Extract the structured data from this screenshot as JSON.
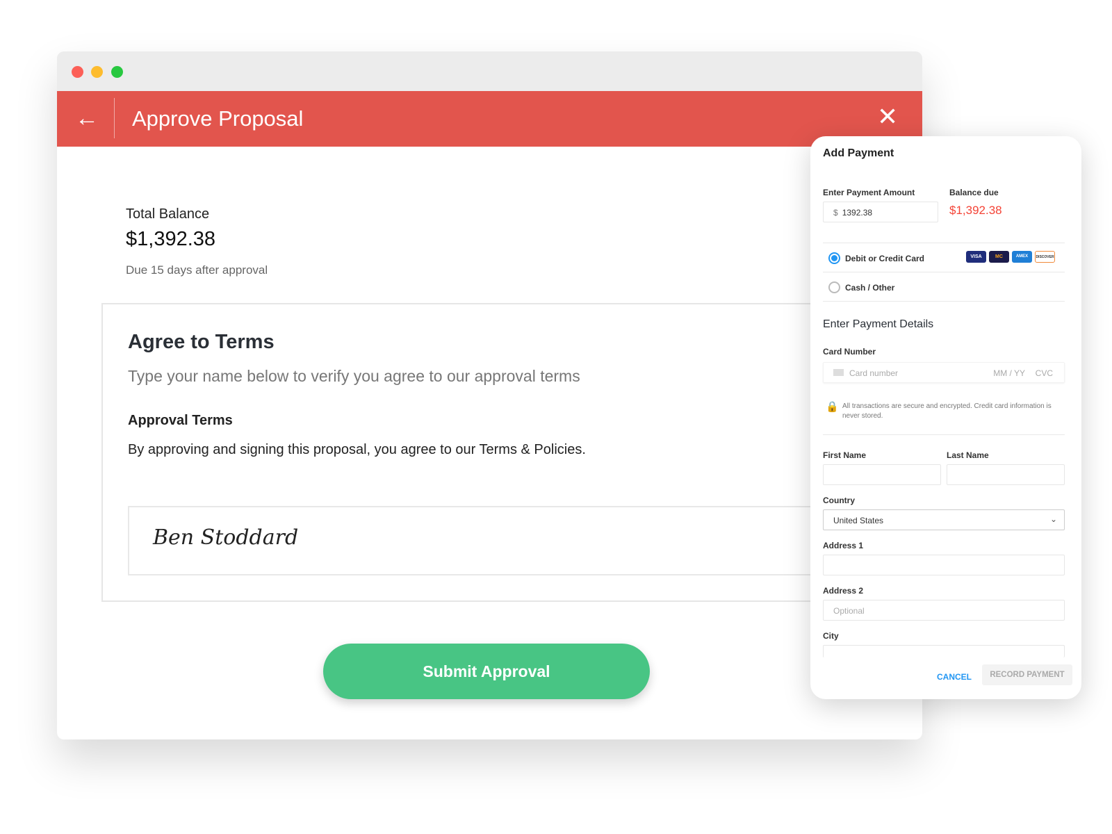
{
  "header": {
    "title": "Approve Proposal"
  },
  "balance": {
    "label": "Total Balance",
    "amount": "$1,392.38",
    "due": "Due 15 days after approval"
  },
  "terms": {
    "title": "Agree to Terms",
    "subtitle": "Type your name below to verify you agree to our approval terms",
    "heading": "Approval Terms",
    "text": "By approving and signing this proposal, you agree to our Terms & Policies.",
    "signature": "Ben Stoddard"
  },
  "submit_label": "Submit Approval",
  "payment": {
    "title": "Add Payment",
    "amount_label": "Enter Payment Amount",
    "currency": "$",
    "amount_value": "1392.38",
    "balance_label": "Balance due",
    "balance_value": "$1,392.38",
    "methods": [
      {
        "label": "Debit or Credit Card",
        "selected": true
      },
      {
        "label": "Cash / Other",
        "selected": false
      }
    ],
    "cards": [
      "VISA",
      "MC",
      "AMEX",
      "DISCOVER"
    ],
    "details_title": "Enter Payment Details",
    "card_label": "Card Number",
    "card_placeholder": "Card number",
    "expiry_placeholder": "MM / YY",
    "cvc_placeholder": "CVC",
    "secure_note": "All transactions are secure and encrypted. Credit card information is never stored.",
    "first_name_label": "First Name",
    "last_name_label": "Last Name",
    "country_label": "Country",
    "country_value": "United States",
    "address1_label": "Address 1",
    "address2_label": "Address 2",
    "address2_placeholder": "Optional",
    "city_label": "City",
    "cancel_label": "CANCEL",
    "record_label": "RECORD PAYMENT"
  },
  "colors": {
    "header": "#e2554d",
    "submit": "#48c584",
    "balance_due": "#f44336",
    "accent": "#2196f3"
  }
}
